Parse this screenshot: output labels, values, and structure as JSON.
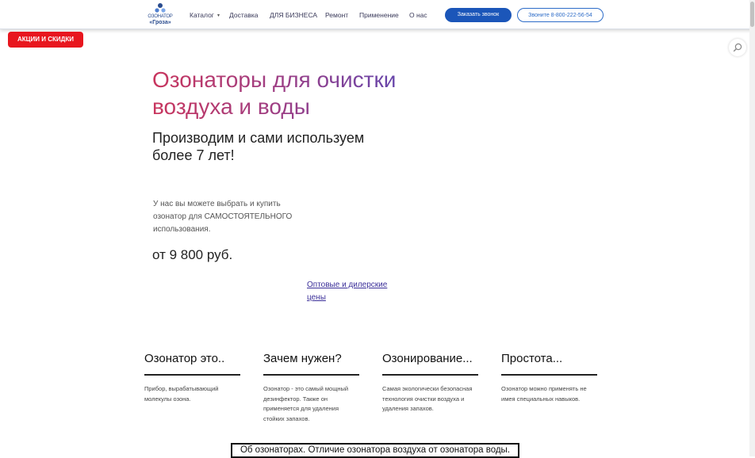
{
  "header": {
    "logo": {
      "line1": "ОЗОНАТОР",
      "line2": "«Гроза»"
    },
    "nav": {
      "catalog": "Каталог",
      "caret": "▾",
      "delivery": "Доставка",
      "business": "ДЛЯ БИЗНЕСА",
      "repair": "Ремонт",
      "usage": "Применение",
      "about": "О нас"
    },
    "call_button": "Заказать звонок",
    "phone_button": "Звоните 8-800-222-56-54"
  },
  "promo_button": "АКЦИИ И СКИДКИ",
  "hero": {
    "title": "Озонаторы для очистки воздуха и воды",
    "subtitle": "Производим и сами используем более 7 лет!",
    "description": "У нас вы можете выбрать и купить озонатор для САМОСТОЯТЕЛЬНОГО использования.",
    "price": "от 9 800 руб.",
    "wholesale_link": "Оптовые и дилерские цены"
  },
  "features": [
    {
      "title": "Озонатор это..",
      "text": "Прибор, вырабатывающий молекулы озона."
    },
    {
      "title": "Зачем нужен?",
      "text": "Озонатор - это самый мощный дезинфектор. Также он применяется для удаления стойких запахов."
    },
    {
      "title": "Озонирование...",
      "text": "Самая экологически безопасная технология очистки воздуха и удаления запахов."
    },
    {
      "title": "Простота...",
      "text": "Озонатор можно применять не имея специальных навыков."
    }
  ],
  "about_heading": "Об озонаторах. Отличие озонатора воздуха от озонатора воды.",
  "colors": {
    "primary_blue": "#1b56b9",
    "promo_red": "#e8161e",
    "title_gradient_start": "#c9365e",
    "title_gradient_end": "#5b47b3",
    "link_purple": "#3b2f99"
  },
  "icons": {
    "search_fab": "magnifier-icon",
    "logo": "ozone-molecule-icon"
  }
}
